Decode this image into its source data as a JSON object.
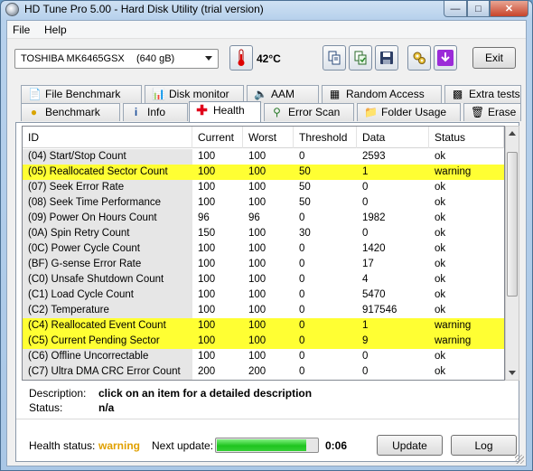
{
  "window": {
    "title": "HD Tune Pro 5.00 - Hard Disk Utility (trial version)"
  },
  "menu": {
    "file": "File",
    "help": "Help"
  },
  "toolbar": {
    "drive_name": "TOSHIBA MK6465GSX",
    "drive_capacity": "(640 gB)",
    "temperature": "42°C",
    "exit_label": "Exit"
  },
  "tabs_top": [
    {
      "label": "File Benchmark",
      "icon": "file-benchmark-icon"
    },
    {
      "label": "Disk monitor",
      "icon": "disk-monitor-icon"
    },
    {
      "label": "AAM",
      "icon": "speaker-icon"
    },
    {
      "label": "Random Access",
      "icon": "random-access-icon"
    },
    {
      "label": "Extra tests",
      "icon": "extra-tests-icon"
    }
  ],
  "tabs_bottom": [
    {
      "label": "Benchmark",
      "icon": "bulb-icon"
    },
    {
      "label": "Info",
      "icon": "info-icon"
    },
    {
      "label": "Health",
      "icon": "health-cross-icon",
      "active": true
    },
    {
      "label": "Error Scan",
      "icon": "magnifier-icon"
    },
    {
      "label": "Folder Usage",
      "icon": "folder-icon"
    },
    {
      "label": "Erase",
      "icon": "trash-icon"
    }
  ],
  "table": {
    "headers": [
      "ID",
      "Current",
      "Worst",
      "Threshold",
      "Data",
      "Status"
    ],
    "rows": [
      [
        "(04) Start/Stop Count",
        "100",
        "100",
        "0",
        "2593",
        "ok"
      ],
      [
        "(05) Reallocated Sector Count",
        "100",
        "100",
        "50",
        "1",
        "warning"
      ],
      [
        "(07) Seek Error Rate",
        "100",
        "100",
        "50",
        "0",
        "ok"
      ],
      [
        "(08) Seek Time Performance",
        "100",
        "100",
        "50",
        "0",
        "ok"
      ],
      [
        "(09) Power On Hours Count",
        "96",
        "96",
        "0",
        "1982",
        "ok"
      ],
      [
        "(0A) Spin Retry Count",
        "150",
        "100",
        "30",
        "0",
        "ok"
      ],
      [
        "(0C) Power Cycle Count",
        "100",
        "100",
        "0",
        "1420",
        "ok"
      ],
      [
        "(BF) G-sense Error Rate",
        "100",
        "100",
        "0",
        "17",
        "ok"
      ],
      [
        "(C0) Unsafe Shutdown Count",
        "100",
        "100",
        "0",
        "4",
        "ok"
      ],
      [
        "(C1) Load Cycle Count",
        "100",
        "100",
        "0",
        "5470",
        "ok"
      ],
      [
        "(C2) Temperature",
        "100",
        "100",
        "0",
        "917546",
        "ok"
      ],
      [
        "(C4) Reallocated Event Count",
        "100",
        "100",
        "0",
        "1",
        "warning"
      ],
      [
        "(C5) Current Pending Sector",
        "100",
        "100",
        "0",
        "9",
        "warning"
      ],
      [
        "(C6) Offline Uncorrectable",
        "100",
        "100",
        "0",
        "0",
        "ok"
      ],
      [
        "(C7) Ultra DMA CRC Error Count",
        "200",
        "200",
        "0",
        "0",
        "ok"
      ]
    ]
  },
  "details": {
    "description_label": "Description:",
    "description_value": "click on an item for a detailed description",
    "status_label": "Status:",
    "status_value": "n/a"
  },
  "footer": {
    "health_label": "Health status:",
    "health_value": "warning",
    "next_update_label": "Next update:",
    "next_update_value": "0:06",
    "progress_fraction": 0.88,
    "update_label": "Update",
    "log_label": "Log"
  },
  "colors": {
    "warning_row": "#ffff33",
    "warning_text": "#e0a000",
    "progress": "#1ec41e"
  }
}
